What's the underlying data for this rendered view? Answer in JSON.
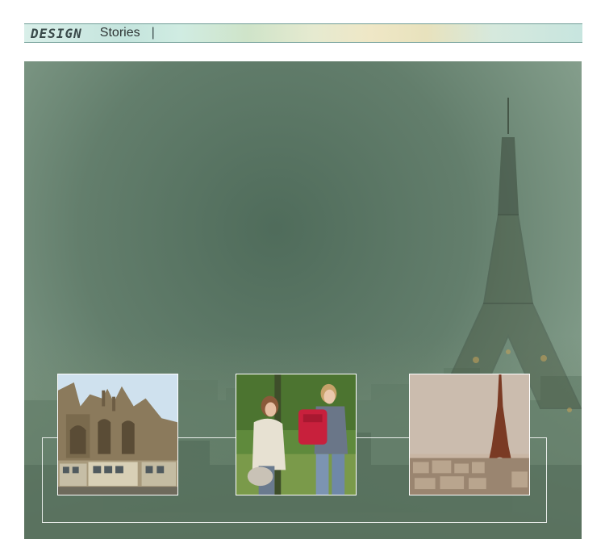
{
  "header": {
    "brand": "DESIGN",
    "title": "Stories",
    "separator": "|"
  },
  "hero": {
    "photos": [
      {
        "subject": "gothic-palace-photo"
      },
      {
        "subject": "two-women-backpack-photo"
      },
      {
        "subject": "eiffel-tower-city-photo"
      }
    ]
  }
}
